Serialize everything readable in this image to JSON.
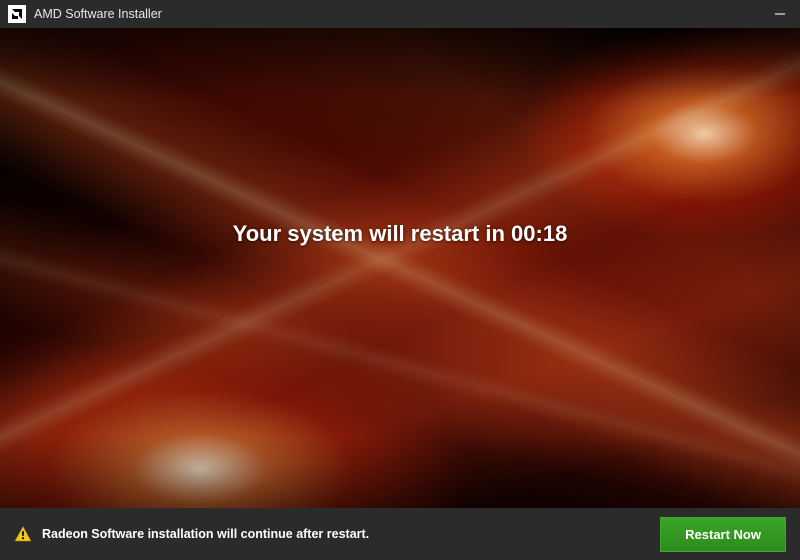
{
  "titlebar": {
    "title": "AMD Software Installer"
  },
  "main": {
    "restart_prefix": "Your system will restart in ",
    "countdown": "00:18"
  },
  "footer": {
    "status_text": "Radeon Software installation will continue after restart.",
    "restart_button_label": "Restart Now"
  },
  "colors": {
    "accent_green": "#2e8b1e",
    "warning_yellow": "#f5c518",
    "titlebar_bg": "#2b2b2b"
  }
}
